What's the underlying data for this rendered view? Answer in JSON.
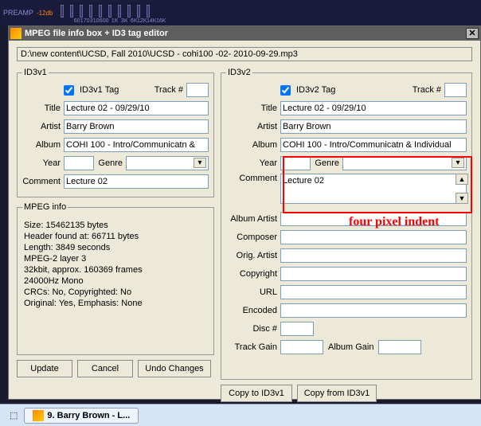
{
  "eq": {
    "preamp": "PREAMP",
    "db": "-12db",
    "bands": [
      "60",
      "170",
      "310",
      "600",
      "1K",
      "3K",
      "6K",
      "12K",
      "14K",
      "16K"
    ]
  },
  "window": {
    "title": "MPEG file info box + ID3 tag editor"
  },
  "filepath": "D:\\new content\\UCSD, Fall 2010\\UCSD - cohi100 -02- 2010-09-29.mp3",
  "id3v1": {
    "legend": "ID3v1",
    "enable_label": "ID3v1 Tag",
    "track_label": "Track #",
    "track": "",
    "title_label": "Title",
    "title": "Lecture 02 - 09/29/10",
    "artist_label": "Artist",
    "artist": "Barry Brown",
    "album_label": "Album",
    "album": "COHI 100 - Intro/Communicatn &",
    "year_label": "Year",
    "year": "",
    "genre_label": "Genre",
    "genre": "",
    "comment_label": "Comment",
    "comment": "Lecture 02"
  },
  "id3v2": {
    "legend": "ID3v2",
    "enable_label": "ID3v2 Tag",
    "track_label": "Track #",
    "track": "",
    "title_label": "Title",
    "title": "Lecture 02 - 09/29/10",
    "artist_label": "Artist",
    "artist": "Barry Brown",
    "album_label": "Album",
    "album": "COHI 100 - Intro/Communicatn & Individual",
    "year_label": "Year",
    "year": "",
    "genre_label": "Genre",
    "genre": "",
    "comment_label": "Comment",
    "comment": "Lecture 02",
    "album_artist_label": "Album Artist",
    "album_artist": "",
    "composer_label": "Composer",
    "composer": "",
    "orig_artist_label": "Orig. Artist",
    "orig_artist": "",
    "copyright_label": "Copyright",
    "copyright": "",
    "url_label": "URL",
    "url": "",
    "encoded_label": "Encoded",
    "encoded": "",
    "disc_label": "Disc #",
    "disc": "",
    "track_gain_label": "Track Gain",
    "track_gain": "",
    "album_gain_label": "Album Gain",
    "album_gain": ""
  },
  "mpeg": {
    "legend": "MPEG info",
    "lines": {
      "size": "Size: 15462135 bytes",
      "header": "Header found at: 66711 bytes",
      "length": "Length: 3849 seconds",
      "layer": "MPEG-2 layer 3",
      "bitrate": "32kbit, approx. 160369 frames",
      "freq": "24000Hz Mono",
      "crc": "CRCs: No, Copyrighted: No",
      "orig": "Original: Yes, Emphasis: None"
    }
  },
  "buttons": {
    "update": "Update",
    "cancel": "Cancel",
    "undo": "Undo Changes",
    "copy_to_v1": "Copy to ID3v1",
    "copy_from_v1": "Copy from ID3v1"
  },
  "annotation": "four pixel indent",
  "taskbar": {
    "item": "9. Barry Brown - L..."
  }
}
